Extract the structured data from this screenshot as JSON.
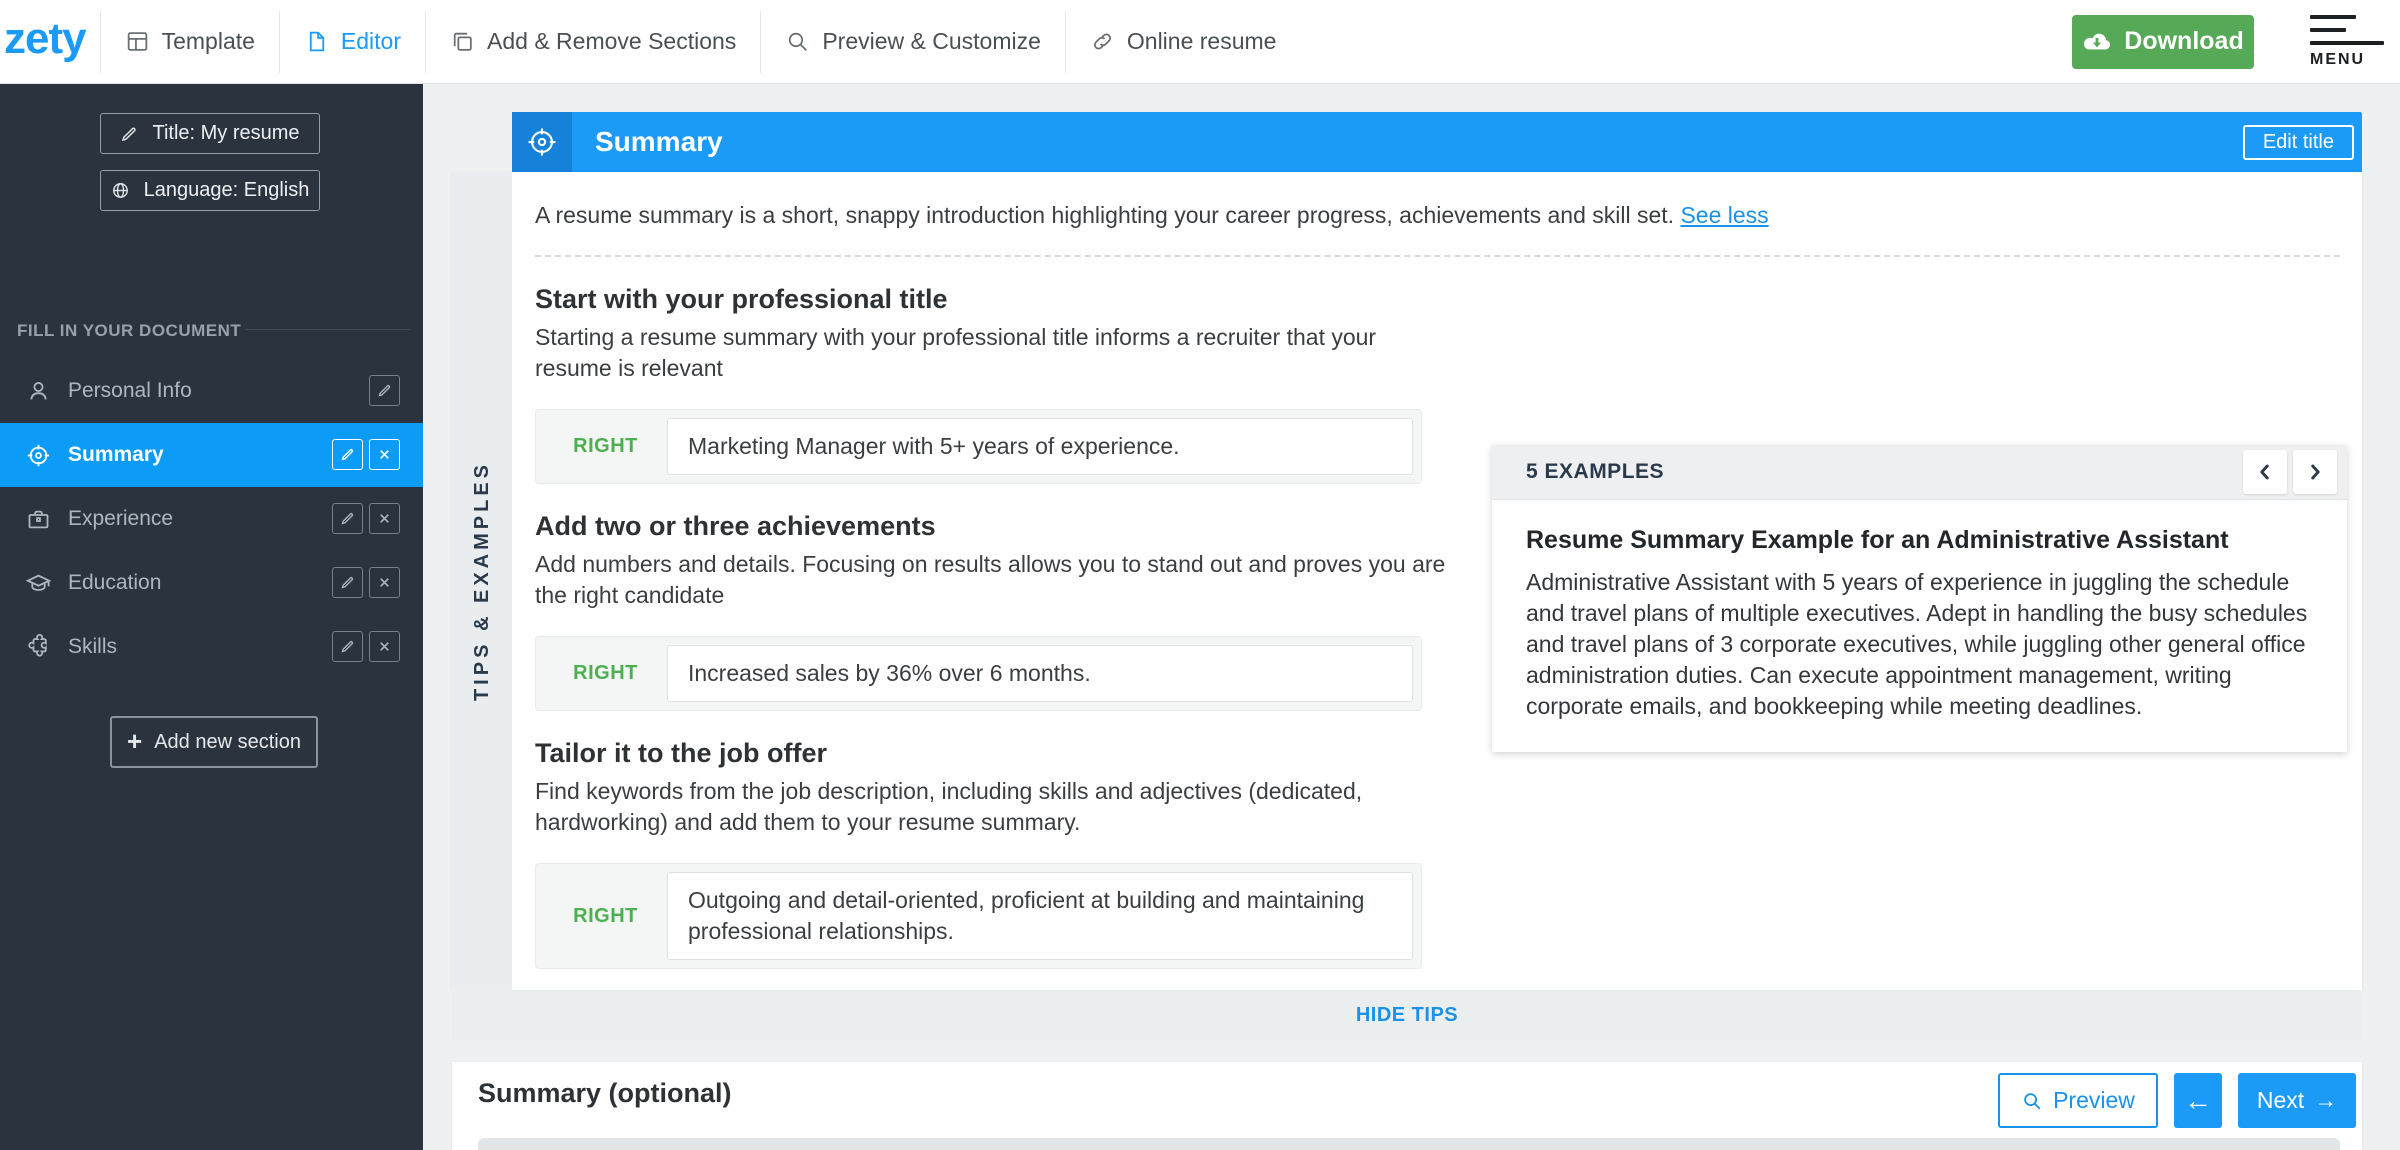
{
  "colors": {
    "accent": "#1b9af8",
    "accent_dark": "#1581d8",
    "link_blue": "#1a91eb",
    "green": "#56a957",
    "right_green": "#4caf50",
    "sidebar_bg": "#2b333e",
    "selected_blue": "#0d9bf8"
  },
  "nav": {
    "logo": "zety",
    "items": [
      {
        "label": "Template",
        "active": false
      },
      {
        "label": "Editor",
        "active": true
      },
      {
        "label": "Add & Remove Sections",
        "active": false
      },
      {
        "label": "Preview & Customize",
        "active": false
      },
      {
        "label": "Online resume",
        "active": false
      }
    ],
    "download_label": "Download",
    "menu_label": "MENU"
  },
  "sidebar": {
    "title_button": "Title: My resume",
    "language_button": "Language: English",
    "section_header": "FILL IN YOUR DOCUMENT",
    "items": [
      {
        "label": "Personal Info"
      },
      {
        "label": "Summary"
      },
      {
        "label": "Experience"
      },
      {
        "label": "Education"
      },
      {
        "label": "Skills"
      }
    ],
    "add_button": "Add new section",
    "add_plus": "+"
  },
  "tips": {
    "header_title": "Summary",
    "edit_button": "Edit title",
    "intro": "A resume summary is a short, snappy introduction highlighting your career progress, achievements and skill set.",
    "see_less": "See less",
    "ribbon": "TIPS & EXAMPLES",
    "sections": [
      {
        "heading": "Start with your professional title",
        "body": "Starting a resume summary with your professional title informs a recruiter that your resume is relevant",
        "example_label": "RIGHT",
        "example": "Marketing Manager with 5+ years of experience."
      },
      {
        "heading": "Add two or three achievements",
        "body": "Add numbers and details. Focusing on results allows you to stand out and proves you are the right candidate",
        "example_label": "RIGHT",
        "example": "Increased sales by 36% over 6 months."
      },
      {
        "heading": "Tailor it to the job offer",
        "body": "Find keywords from the job description, including skills and adjectives (dedicated, hardworking) and add them to your resume summary.",
        "example_label": "RIGHT",
        "example": "Outgoing and detail-oriented, proficient at building and maintaining professional relationships."
      }
    ],
    "examples_card": {
      "count_label": "5 EXAMPLES",
      "title": "Resume Summary Example for an Administrative Assistant",
      "body": "Administrative Assistant with 5 years of experience in juggling the schedule and travel plans of multiple executives. Adept in handling the busy schedules and travel plans of 3 corporate executives, while juggling other general office administration duties. Can execute appointment management, writing corporate emails, and bookkeeping while meeting deadlines."
    },
    "hide_tips": "HIDE TIPS"
  },
  "editor_panel": {
    "heading": "Summary (optional)",
    "preview_button": "Preview",
    "back_arrow": "←",
    "next_button": "Next",
    "next_arrow": "→"
  }
}
